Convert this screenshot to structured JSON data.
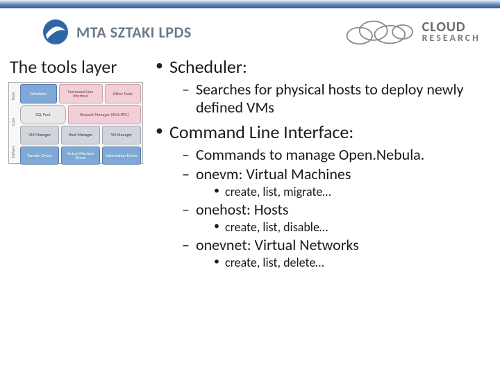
{
  "header": {
    "logo_left_text": "MTA SZTAKI LPDS",
    "logo_right_line1": "CLOUD",
    "logo_right_line2": "RESEARCH"
  },
  "section_title": "The tools layer",
  "thumb": {
    "side_labels": [
      "Tools",
      "Core",
      "Drivers"
    ],
    "r1": [
      "Scheduler",
      "Command Line Interface",
      "Other Tools"
    ],
    "r2": [
      "SQL Pool",
      "Request Manager (XML-RPC)"
    ],
    "r3a": [
      "VM Manager",
      "Host Manager",
      "VN Manager"
    ],
    "r3b": [
      "Transfer Driver",
      "Virtual Machine Driver",
      "Information Driver"
    ]
  },
  "bullets": {
    "scheduler": {
      "title": "Scheduler:",
      "sub1": "Searches for physical hosts to deploy newly defined VMs"
    },
    "cli": {
      "title": "Command Line Interface:",
      "sub1": "Commands to manage Open.Nebula.",
      "onevm_label": "onevm: Virtual Machines",
      "onevm_ops": "create, list, migrate…",
      "onehost_label": "onehost: Hosts",
      "onehost_ops": "create, list, disable…",
      "onevnet_label": "onevnet: Virtual Networks",
      "onevnet_ops": "create, list, delete…"
    }
  }
}
